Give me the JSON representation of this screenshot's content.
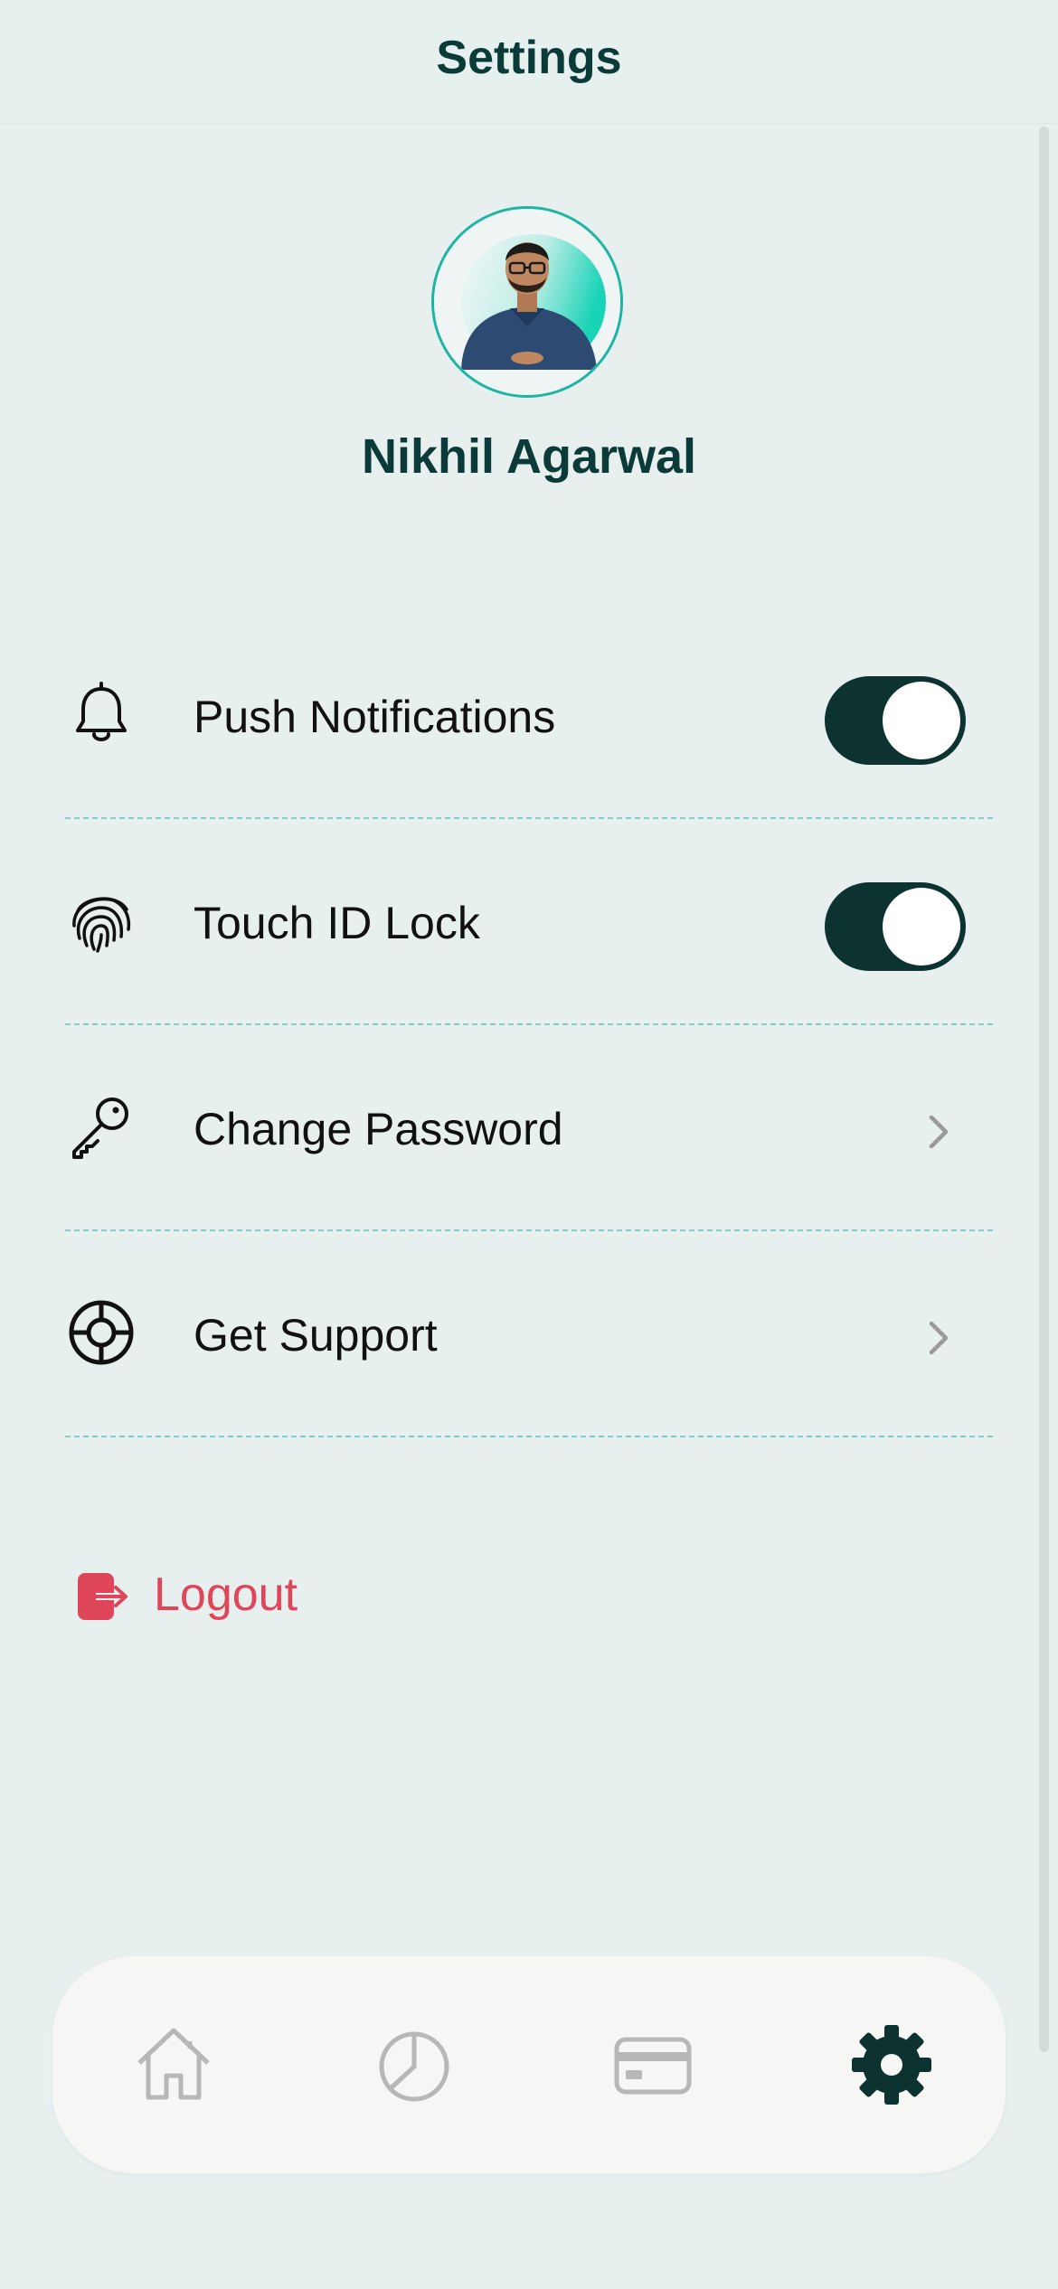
{
  "header": {
    "title": "Settings"
  },
  "profile": {
    "name": "Nikhil Agarwal",
    "avatar": "user-photo"
  },
  "settings": [
    {
      "label": "Push Notifications",
      "icon": "bell-icon",
      "control": "toggle",
      "on": true
    },
    {
      "label": "Touch ID Lock",
      "icon": "fingerprint-icon",
      "control": "toggle",
      "on": true
    },
    {
      "label": "Change Password",
      "icon": "key-icon",
      "control": "chevron"
    },
    {
      "label": "Get Support",
      "icon": "lifebuoy-icon",
      "control": "chevron"
    }
  ],
  "logout": {
    "label": "Logout",
    "icon": "logout-icon"
  },
  "tabbar": {
    "tabs": [
      {
        "icon": "home-icon",
        "active": false
      },
      {
        "icon": "pie-chart-icon",
        "active": false
      },
      {
        "icon": "card-icon",
        "active": false
      },
      {
        "icon": "gear-icon",
        "active": true
      }
    ]
  },
  "colors": {
    "background": "#e7f0ef",
    "primary_dark": "#0d3330",
    "accent_teal": "#1fb5a5",
    "danger": "#e0465a",
    "inactive_icon": "#b7b7b7"
  }
}
